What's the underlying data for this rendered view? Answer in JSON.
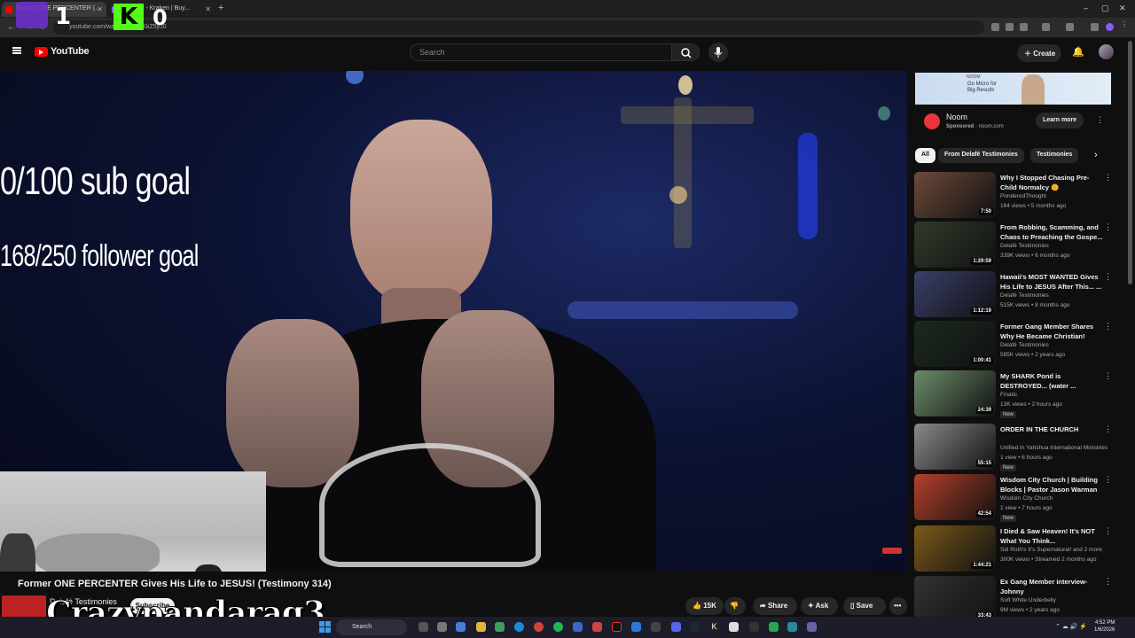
{
  "browser": {
    "tabs": [
      {
        "label": "Former ONE PERCENTER (...",
        "active": true,
        "color": "#ff0000"
      },
      {
        "label": "account - Kraken | Buy...",
        "active": false,
        "color": "#7b61ff"
      }
    ],
    "new_tab": "+",
    "url": "youtube.com/watch?v=...XKkZ5yJ0"
  },
  "overlay": {
    "twitch_count": "1",
    "kick_logo": "K",
    "kick_count": "0",
    "sub_goal": "0/100 sub goal",
    "follower_goal": "168/250 follower goal",
    "streamer_name": "Crazypandarag3"
  },
  "youtube": {
    "logo_text": "YouTube",
    "search_placeholder": "Search",
    "create_label": "Create"
  },
  "video": {
    "title": "Former ONE PERCENTER Gives His Life to JESUS! (Testimony 314)",
    "channel": "Delafé Testimonies",
    "subscribe_label": "Subscribe",
    "likes": "15K",
    "share_label": "Share",
    "ask_label": "Ask",
    "save_label": "Save"
  },
  "ad": {
    "banner_brand": "NOOM",
    "banner_text": "Go Micro for Big Results",
    "name": "Noom",
    "sponsored": "Sponsored",
    "domain": "noom.com",
    "learn_more": "Learn more"
  },
  "chips": [
    "All",
    "From Delafé Testimonies",
    "Testimonies"
  ],
  "recommendations": [
    {
      "title": "Why I Stopped Chasing Pre-Child Normalcy 🌼",
      "channel": "PonderedThought",
      "meta": "164 views • 5 months ago",
      "duration": "7:50",
      "badge": "",
      "thumb": "#6b4a3a"
    },
    {
      "title": "From Robbing, Scamming, and Chaos to Preaching the Gospe...",
      "channel": "Delafé Testimonies",
      "meta": "339K views • 6 months ago",
      "duration": "1:29:59",
      "badge": "",
      "thumb": "#2f3b2a"
    },
    {
      "title": "Hawaii's MOST WANTED Gives His Life to JESUS After This... ...",
      "channel": "Delafé Testimonies",
      "meta": "515K views • 8 months ago",
      "duration": "1:12:19",
      "badge": "",
      "thumb": "#3a3f6b"
    },
    {
      "title": "Former Gang Member Shares Why He Became Christian!",
      "channel": "Delafé Testimonies",
      "meta": "585K views • 2 years ago",
      "duration": "1:00:41",
      "badge": "",
      "thumb": "#1b2a1f"
    },
    {
      "title": "My SHARK Pond is DESTROYED... (water ...",
      "channel": "Finatic",
      "meta": "13K views • 2 hours ago",
      "duration": "24:39",
      "badge": "New",
      "thumb": "#6c8b6a"
    },
    {
      "title": "ORDER IN THE CHURCH",
      "channel": "Unified In Yahshua International Ministries",
      "meta": "1 view • 6 hours ago",
      "duration": "55:15",
      "badge": "New",
      "thumb": "#8a8a8a"
    },
    {
      "title": "Wisdom City Church | Building Blocks | Pastor Jason Warman",
      "channel": "Wisdom City Church",
      "meta": "1 view • 7 hours ago",
      "duration": "42:54",
      "badge": "New",
      "thumb": "#b5402a"
    },
    {
      "title": "I Died & Saw Heaven! It's NOT What You Think...",
      "channel": "Sid Roth's It's Supernatural! and 2 more",
      "meta": "300K views • Streamed 2 months ago",
      "duration": "1:44:21",
      "badge": "",
      "thumb": "#7a5a1a"
    },
    {
      "title": "Ex Gang Member interview- Johnny",
      "channel": "Soft White Underbelly",
      "meta": "9M views • 2 years ago",
      "duration": "33:43",
      "badge": "",
      "thumb": "#333333"
    }
  ],
  "taskbar": {
    "search_label": "Search",
    "time": "4:52 PM",
    "date": "1/6/2026"
  }
}
